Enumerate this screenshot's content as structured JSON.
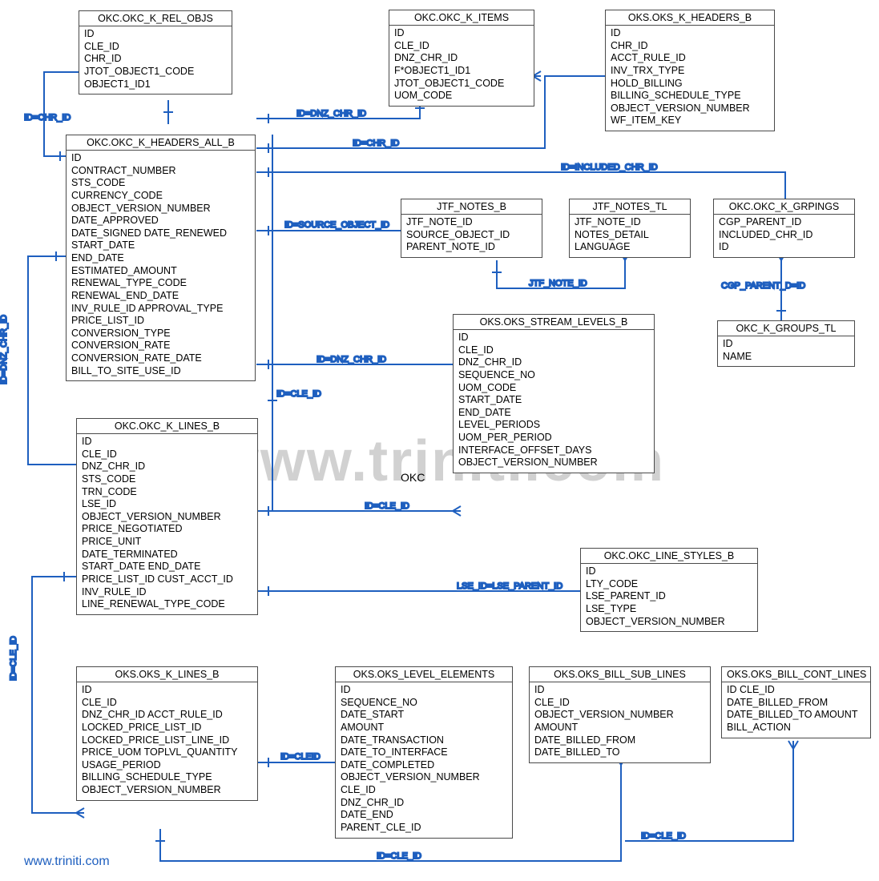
{
  "watermark": "www.triniti.com",
  "footer": "www.triniti.com",
  "okc_label": "OKC",
  "entities": {
    "rel_objs": {
      "title": "OKC.OKC_K_REL_OBJS",
      "fields": [
        "ID",
        "CLE_ID",
        "CHR_ID",
        "JTOT_OBJECT1_CODE",
        "OBJECT1_ID1"
      ]
    },
    "items": {
      "title": "OKC.OKC_K_ITEMS",
      "fields": [
        "ID",
        "CLE_ID",
        "DNZ_CHR_ID",
        "F*OBJECT1_ID1",
        "JTOT_OBJECT1_CODE",
        "UOM_CODE"
      ]
    },
    "oks_headers": {
      "title": "OKS.OKS_K_HEADERS_B",
      "fields": [
        "ID",
        "CHR_ID",
        "ACCT_RULE_ID",
        "INV_TRX_TYPE",
        "HOLD_BILLING",
        "BILLING_SCHEDULE_TYPE",
        "OBJECT_VERSION_NUMBER",
        "WF_ITEM_KEY"
      ]
    },
    "headers": {
      "title": "OKC.OKC_K_HEADERS_ALL_B",
      "fields": [
        "ID",
        "CONTRACT_NUMBER",
        "STS_CODE",
        "CURRENCY_CODE",
        "OBJECT_VERSION_NUMBER",
        "DATE_APPROVED",
        "DATE_SIGNED DATE_RENEWED",
        "START_DATE",
        "END_DATE",
        "ESTIMATED_AMOUNT",
        "RENEWAL_TYPE_CODE",
        "RENEWAL_END_DATE",
        "INV_RULE_ID APPROVAL_TYPE",
        "PRICE_LIST_ID",
        "CONVERSION_TYPE",
        "CONVERSION_RATE",
        "CONVERSION_RATE_DATE",
        "BILL_TO_SITE_USE_ID"
      ]
    },
    "notes_b": {
      "title": "JTF_NOTES_B",
      "fields": [
        "JTF_NOTE_ID",
        "SOURCE_OBJECT_ID",
        "PARENT_NOTE_ID"
      ]
    },
    "notes_tl": {
      "title": "JTF_NOTES_TL",
      "fields": [
        "JTF_NOTE_ID",
        "NOTES_DETAIL",
        "LANGUAGE"
      ]
    },
    "grpings": {
      "title": "OKC.OKC_K_GRPINGS",
      "fields": [
        "CGP_PARENT_ID",
        "INCLUDED_CHR_ID",
        "ID"
      ]
    },
    "groups_tl": {
      "title": "OKC_K_GROUPS_TL",
      "fields": [
        "ID",
        "NAME"
      ]
    },
    "stream": {
      "title": "OKS.OKS_STREAM_LEVELS_B",
      "fields": [
        "ID",
        "CLE_ID",
        "DNZ_CHR_ID",
        "SEQUENCE_NO",
        "UOM_CODE",
        "START_DATE",
        "END_DATE",
        "LEVEL_PERIODS",
        "UOM_PER_PERIOD",
        "INTERFACE_OFFSET_DAYS",
        "OBJECT_VERSION_NUMBER"
      ]
    },
    "lines": {
      "title": "OKC.OKC_K_LINES_B",
      "fields": [
        "ID",
        "CLE_ID",
        "DNZ_CHR_ID",
        "STS_CODE",
        "TRN_CODE",
        "LSE_ID",
        "OBJECT_VERSION_NUMBER",
        "PRICE_NEGOTIATED",
        "PRICE_UNIT",
        "DATE_TERMINATED",
        "START_DATE END_DATE",
        "PRICE_LIST_ID CUST_ACCT_ID",
        "INV_RULE_ID",
        "LINE_RENEWAL_TYPE_CODE"
      ]
    },
    "line_styles": {
      "title": "OKC.OKC_LINE_STYLES_B",
      "fields": [
        "ID",
        "LTY_CODE",
        "LSE_PARENT_ID",
        "LSE_TYPE",
        "OBJECT_VERSION_NUMBER"
      ]
    },
    "oks_lines": {
      "title": "OKS.OKS_K_LINES_B",
      "fields": [
        "ID",
        "CLE_ID",
        "DNZ_CHR_ID ACCT_RULE_ID",
        "LOCKED_PRICE_LIST_ID",
        "LOCKED_PRICE_LIST_LINE_ID",
        "PRICE_UOM TOPLVL_QUANTITY",
        "USAGE_PERIOD",
        "BILLING_SCHEDULE_TYPE",
        "OBJECT_VERSION_NUMBER"
      ]
    },
    "level_elems": {
      "title": "OKS.OKS_LEVEL_ELEMENTS",
      "fields": [
        "ID",
        "SEQUENCE_NO",
        "DATE_START",
        "AMOUNT",
        "DATE_TRANSACTION",
        "DATE_TO_INTERFACE",
        "DATE_COMPLETED",
        "OBJECT_VERSION_NUMBER",
        "CLE_ID",
        "DNZ_CHR_ID",
        "DATE_END",
        "PARENT_CLE_ID"
      ]
    },
    "bill_sub": {
      "title": "OKS.OKS_BILL_SUB_LINES",
      "fields": [
        "ID",
        "CLE_ID",
        "OBJECT_VERSION_NUMBER",
        "AMOUNT",
        "DATE_BILLED_FROM",
        "DATE_BILLED_TO"
      ]
    },
    "bill_cont": {
      "title": "OKS.OKS_BILL_CONT_LINES",
      "fields": [
        "ID CLE_ID",
        "DATE_BILLED_FROM",
        "DATE_BILLED_TO AMOUNT",
        "BILL_ACTION"
      ]
    }
  },
  "relations": {
    "r1": "ID=CHR_ID",
    "r2": "ID=DNZ_CHR_ID",
    "r3": "ID=CHR_ID",
    "r4": "ID=INCLUDED_CHR_ID",
    "r5": "ID=SOURCE_OBJECT_ID",
    "r6": "JTF_NOTE_ID",
    "r7": "CGP_PARENT_D=ID",
    "r8": "ID=DNZ_CHR_ID",
    "r9": "ID=DNZ_CHR_ID",
    "r10": "ID=CLE_ID",
    "r11": "ID=CLE_ID",
    "r12": "LSE_ID=LSE_PARENT_ID",
    "r13": "ID=CLE_ID",
    "r14": "ID=CLEID",
    "r15": "ID=CLE_ID",
    "r16": "ID=CLE_ID"
  }
}
